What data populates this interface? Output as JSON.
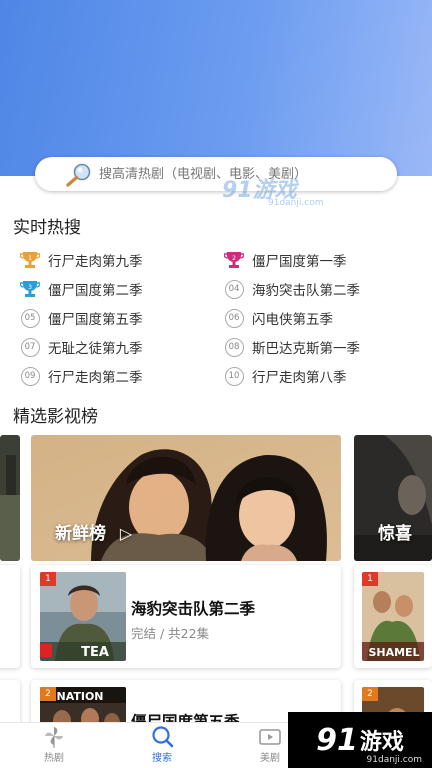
{
  "search": {
    "placeholder": "搜高清热剧（电视剧、电影、美剧）"
  },
  "watermark": {
    "small_logo": "91游戏",
    "small_url": "91danji.com",
    "logo_num": "91",
    "logo_text": "游戏",
    "url": "91danji.com"
  },
  "hot": {
    "title": "实时热搜",
    "items": [
      {
        "rank": "1",
        "label": "行尸走肉第九季",
        "style": "trophy-gold"
      },
      {
        "rank": "2",
        "label": "僵尸国度第一季",
        "style": "trophy-pink"
      },
      {
        "rank": "3",
        "label": "僵尸国度第二季",
        "style": "trophy-blue"
      },
      {
        "rank": "04",
        "label": "海豹突击队第二季",
        "style": "circle"
      },
      {
        "rank": "05",
        "label": "僵尸国度第五季",
        "style": "circle"
      },
      {
        "rank": "06",
        "label": "闪电侠第五季",
        "style": "circle"
      },
      {
        "rank": "07",
        "label": "无耻之徒第九季",
        "style": "circle"
      },
      {
        "rank": "08",
        "label": "斯巴达克斯第一季",
        "style": "circle"
      },
      {
        "rank": "09",
        "label": "行尸走肉第二季",
        "style": "circle"
      },
      {
        "rank": "10",
        "label": "行尸走肉第八季",
        "style": "circle"
      }
    ]
  },
  "featured": {
    "title": "精选影视榜",
    "banner_center": "新鲜榜",
    "banner_right": "惊喜",
    "cards": [
      {
        "badge": "1",
        "title": "海豹突击队第二季",
        "subtitle": "完结 / 共22集",
        "poster_text": "TEA"
      },
      {
        "badge": "2",
        "title": "僵尸国度第五季",
        "poster_text": "NATION"
      }
    ],
    "right_cards": [
      {
        "badge": "1",
        "poster_text": "SHAMEL"
      },
      {
        "badge": "2"
      }
    ]
  },
  "tabs": [
    {
      "label": "热剧",
      "icon": "pinwheel-icon",
      "active": false
    },
    {
      "label": "搜索",
      "icon": "search-icon",
      "active": true
    },
    {
      "label": "美剧",
      "icon": "film-icon",
      "active": false
    }
  ],
  "colors": {
    "accent": "#2f6fe0",
    "hero_start": "#4f86e6",
    "hero_end": "#9ab8f7",
    "badge": "#e0392b"
  }
}
